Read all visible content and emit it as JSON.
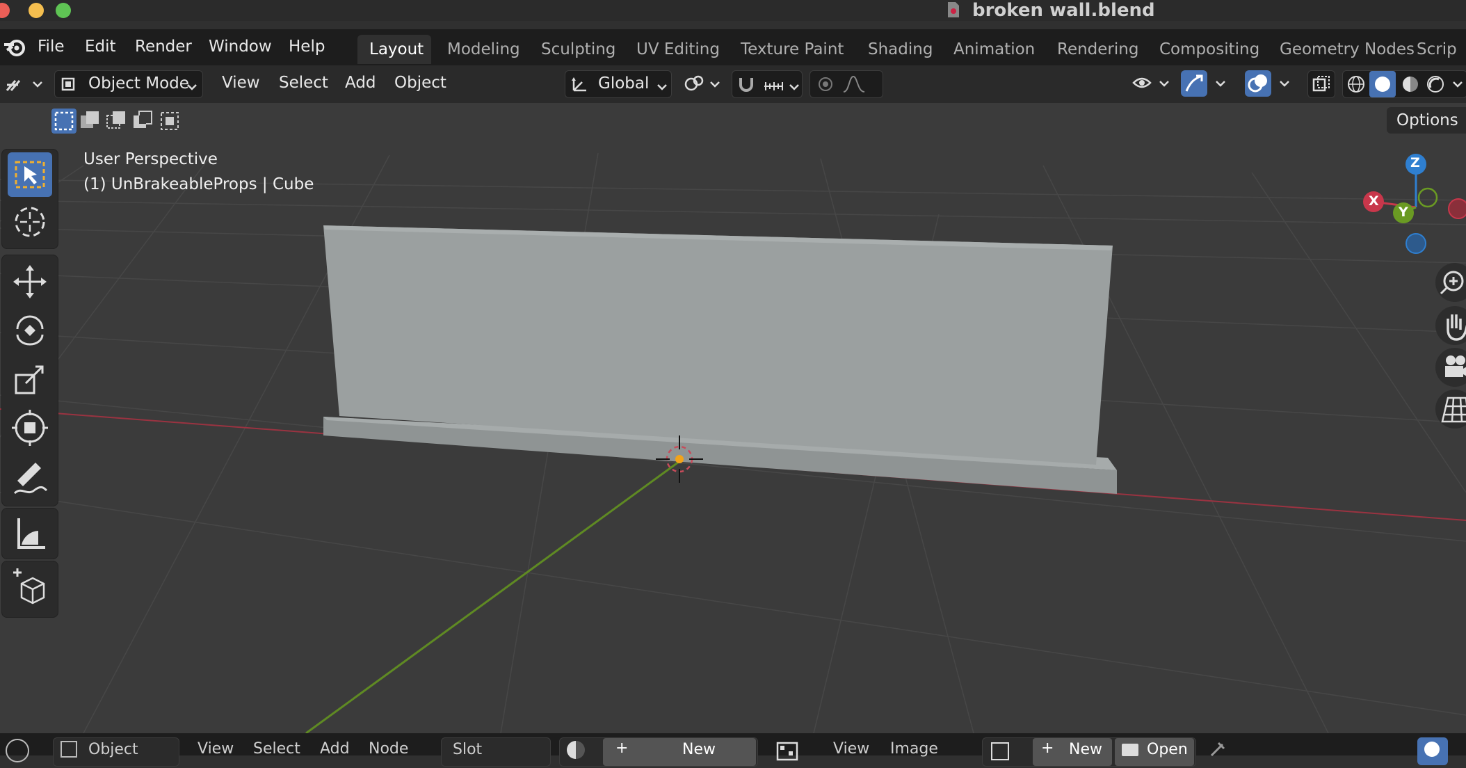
{
  "window": {
    "title": "broken wall.blend"
  },
  "menu": [
    "File",
    "Edit",
    "Render",
    "Window",
    "Help"
  ],
  "workspaces": [
    "Layout",
    "Modeling",
    "Sculpting",
    "UV Editing",
    "Texture Paint",
    "Shading",
    "Animation",
    "Rendering",
    "Compositing",
    "Geometry Nodes",
    "Scrip"
  ],
  "header": {
    "mode": "Object Mode",
    "menus": [
      "View",
      "Select",
      "Add",
      "Object"
    ],
    "orientation": "Global",
    "options_label": "Options"
  },
  "viewport": {
    "perspective": "User Perspective",
    "selection": "(1) UnBrakeableProps | Cube"
  },
  "gizmo": {
    "z": "Z",
    "x": "X",
    "y": "Y"
  },
  "bottom": {
    "object_label": "Object",
    "menus": [
      "View",
      "Select",
      "Add",
      "Node"
    ],
    "slot": "Slot",
    "new_label": "New",
    "image_menus": [
      "View",
      "Image"
    ],
    "new2_label": "New",
    "open_label": "Open"
  },
  "colors": {
    "accent": "#4772b3",
    "x_axis": "#c8374b",
    "y_axis": "#6a9a23",
    "z_axis": "#2f7fd0"
  }
}
